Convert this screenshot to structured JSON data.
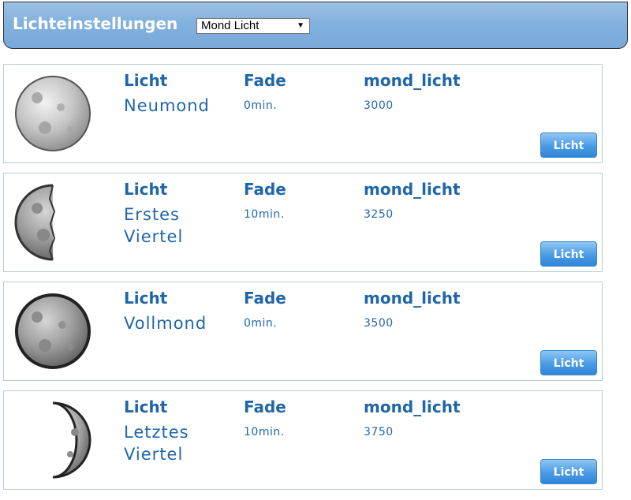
{
  "header": {
    "title": "Lichteinstellungen",
    "select_value": "Mond Licht",
    "select_arrow": "▼"
  },
  "colors": {
    "accent": "#1f66a8",
    "header_bg": "#82b1dd",
    "button": "#4a9be4"
  },
  "column_labels": {
    "light": "Licht",
    "fade": "Fade",
    "value": "mond_licht"
  },
  "cards": [
    {
      "icon": "moon-new-icon",
      "name": "Neumond",
      "fade": "0min.",
      "value": "3000",
      "button": "Licht"
    },
    {
      "icon": "moon-first-quarter-icon",
      "name": "Erstes Viertel",
      "fade": "10min.",
      "value": "3250",
      "button": "Licht"
    },
    {
      "icon": "moon-full-icon",
      "name": "Vollmond",
      "fade": "0min.",
      "value": "3500",
      "button": "Licht"
    },
    {
      "icon": "moon-last-quarter-icon",
      "name": "Letztes Viertel",
      "fade": "10min.",
      "value": "3750",
      "button": "Licht"
    }
  ]
}
